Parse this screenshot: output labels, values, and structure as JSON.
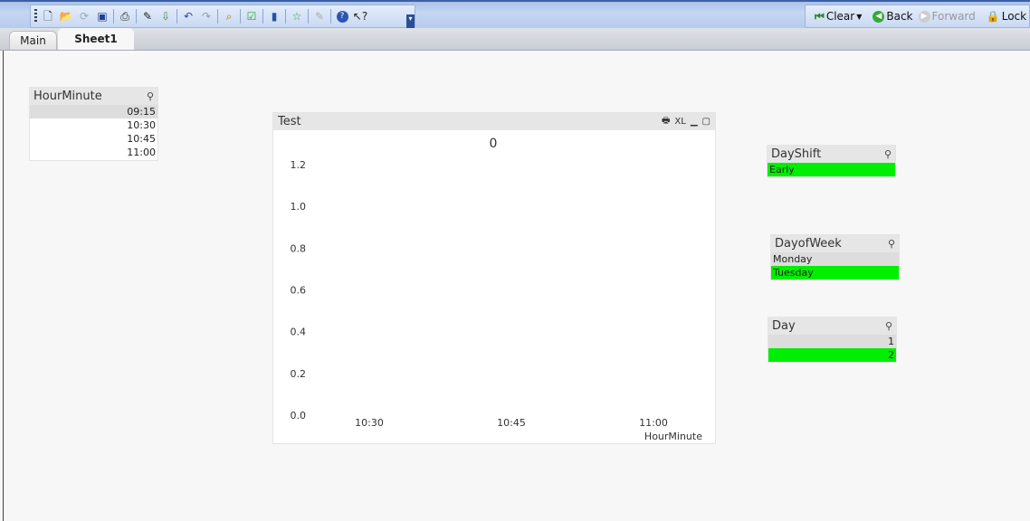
{
  "toolbar": {
    "clear": "Clear",
    "back": "Back",
    "forward": "Forward",
    "lock": "Lock"
  },
  "tabs": [
    "Main",
    "Sheet1"
  ],
  "hourminute": {
    "title": "HourMinute",
    "values": [
      "09:15",
      "10:30",
      "10:45",
      "11:00"
    ]
  },
  "dayshift": {
    "title": "DayShift",
    "values": [
      "Early"
    ]
  },
  "dayofweek": {
    "title": "DayofWeek",
    "values": [
      "Monday",
      "Tuesday"
    ]
  },
  "day": {
    "title": "Day",
    "values": [
      "1",
      "2"
    ]
  },
  "chart": {
    "caption": "Test",
    "excel_label": "XL"
  },
  "chart_data": {
    "type": "line",
    "title": "0",
    "categories": [
      "10:30",
      "10:45",
      "11:00"
    ],
    "series": [],
    "xlabel": "HourMinute",
    "ylabel": "",
    "ylim": [
      0,
      1.2
    ],
    "yticks": [
      "0.0",
      "0.2",
      "0.4",
      "0.6",
      "0.8",
      "1.0",
      "1.2"
    ],
    "grid": false
  },
  "colors": {
    "selected": "#00ee00",
    "alternative": "#dddddd"
  }
}
